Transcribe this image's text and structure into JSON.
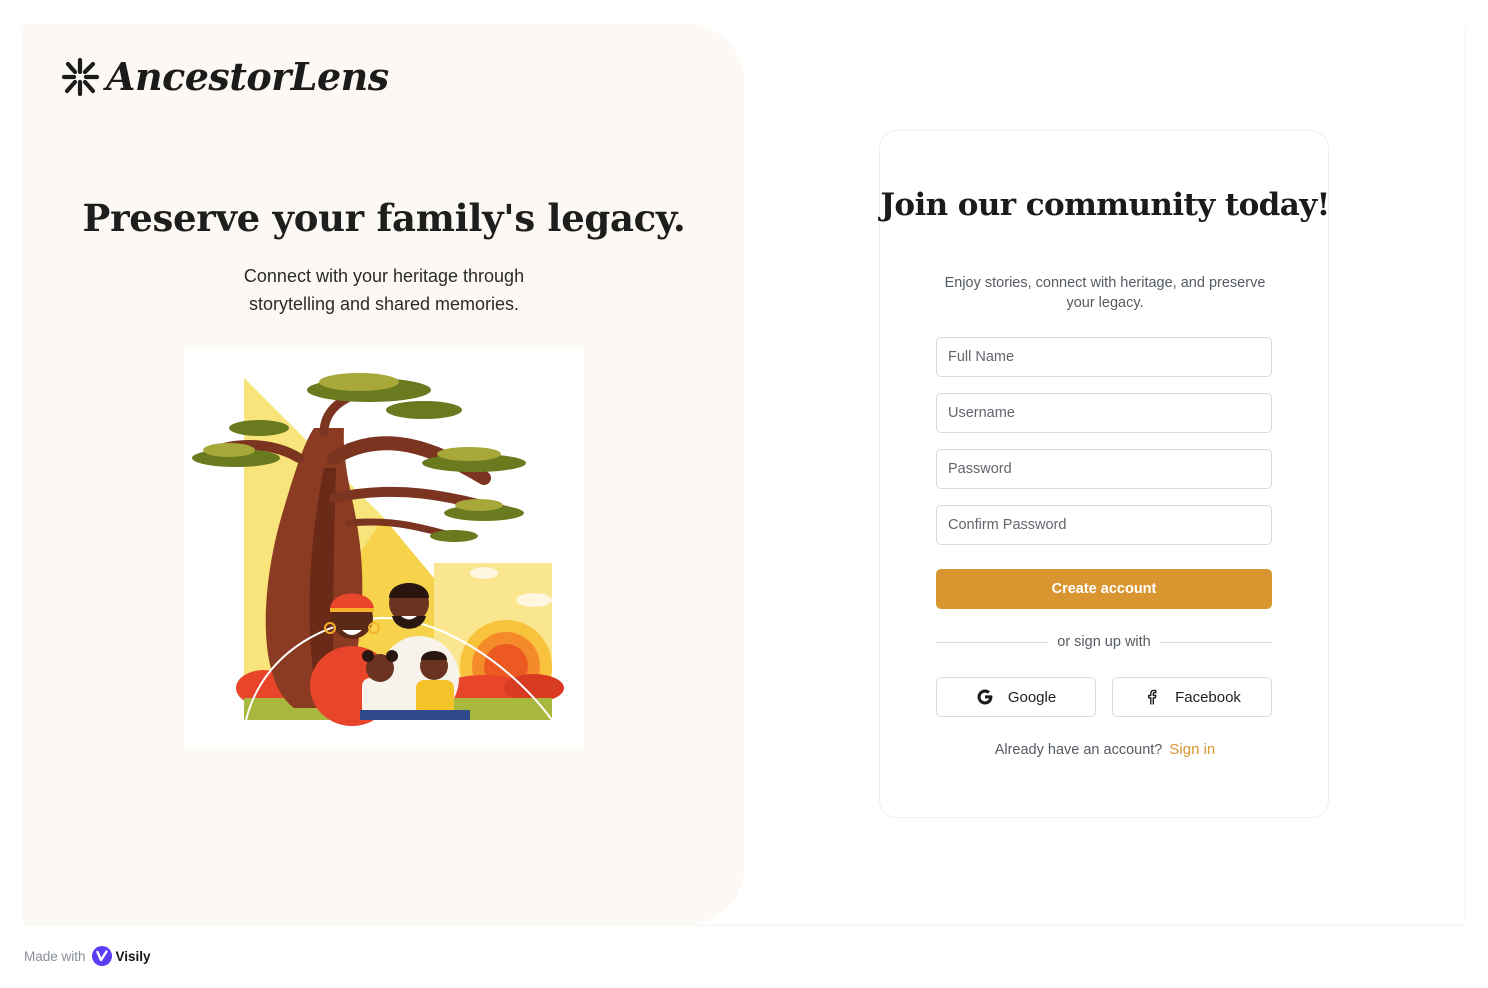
{
  "brand": {
    "name": "AncestorLens"
  },
  "hero": {
    "title": "Preserve your family's legacy.",
    "subtitle": "Connect with your heritage through storytelling and shared memories."
  },
  "signup": {
    "title": "Join our community today!",
    "subtitle": "Enjoy stories, connect with heritage, and preserve your legacy.",
    "fields": {
      "full_name": "Full Name",
      "username": "Username",
      "password": "Password",
      "confirm_password": "Confirm Password"
    },
    "submit_label": "Create account",
    "divider_text": "or sign up with",
    "social": {
      "google": "Google",
      "facebook": "Facebook"
    },
    "signin_prompt": "Already have an account?",
    "signin_link": "Sign in"
  },
  "footer": {
    "made_with": "Made with",
    "tool": "Visily"
  },
  "colors": {
    "accent": "#d99630",
    "panel_bg": "#fcf8f3",
    "text_dark": "#1b1b1b",
    "text_muted": "#555b62"
  },
  "icons": {
    "logo": "asterisk-logo-icon",
    "google": "google-icon",
    "facebook": "facebook-icon",
    "visily": "visily-logo-icon"
  }
}
